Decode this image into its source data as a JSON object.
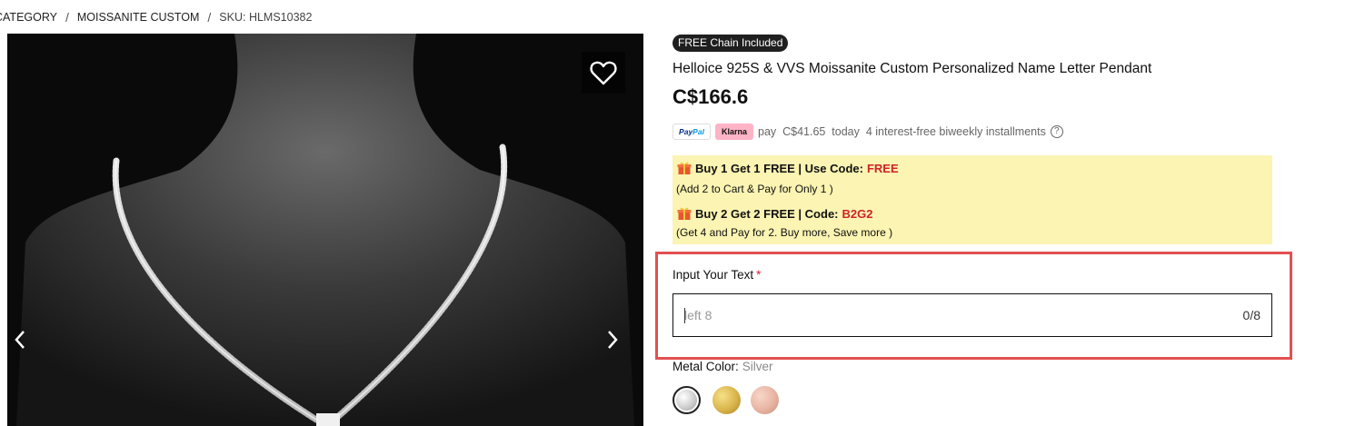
{
  "breadcrumb": {
    "items": [
      "CATEGORY",
      "MOISSANITE CUSTOM"
    ],
    "separator": "/",
    "sku": "SKU: HLMS10382"
  },
  "gallery": {
    "wishlist_icon": "heart-outline-icon",
    "prev_icon": "chevron-left-icon",
    "next_icon": "chevron-right-icon"
  },
  "product": {
    "badge": "FREE Chain Included",
    "title": "Helloice 925S & VVS Moissanite Custom Personalized Name Letter Pendant",
    "price": "C$166.6"
  },
  "payment": {
    "paypal_label": [
      "Pay",
      "Pal"
    ],
    "klarna_label": "Klarna",
    "text": "pay  C$41.65  today  4 interest-free biweekly installments",
    "help_icon": "question-circle-icon"
  },
  "promo": {
    "offer1": {
      "headline": "Buy 1 Get 1 FREE | Use Code:",
      "code": "FREE",
      "note": "(Add 2 to Cart & Pay for Only 1 )"
    },
    "offer2": {
      "headline": "Buy 2 Get 2 FREE | Code:",
      "code": "B2G2",
      "note": "(Get 4 and Pay for 2. Buy more, Save more )"
    },
    "icon": "gift-icon",
    "code_color": "#d0212a"
  },
  "custom_text": {
    "label": "Input Your Text",
    "required_mark": "*",
    "placeholder": "left 8",
    "value": "",
    "counter": "0/8"
  },
  "metal": {
    "label": "Metal Color:",
    "selected": "Silver",
    "options": [
      {
        "name": "Silver",
        "color": "#cfcfcf"
      },
      {
        "name": "Gold",
        "color": "#d9b44a"
      },
      {
        "name": "Rose Gold",
        "color": "#e8b4a2"
      }
    ]
  },
  "colors": {
    "highlight": "#e35050",
    "promo_bg": "#fbf4b2",
    "badge_bg": "#1f1f1f"
  }
}
